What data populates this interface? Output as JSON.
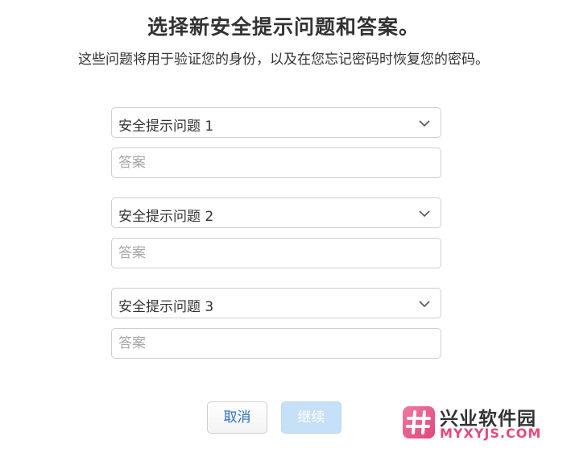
{
  "header": {
    "title": "选择新安全提示问题和答案。",
    "subtitle": "这些问题将用于验证您的身份，以及在您忘记密码时恢复您的密码。"
  },
  "questions": [
    {
      "select_label": "安全提示问题 1",
      "answer_placeholder": "答案",
      "answer_value": ""
    },
    {
      "select_label": "安全提示问题 2",
      "answer_placeholder": "答案",
      "answer_value": ""
    },
    {
      "select_label": "安全提示问题 3",
      "answer_placeholder": "答案",
      "answer_value": ""
    }
  ],
  "actions": {
    "cancel_label": "取消",
    "continue_label": "继续",
    "continue_enabled": false
  },
  "watermark": {
    "name": "兴业软件园",
    "url": "MYXYJS.COM"
  },
  "colors": {
    "link_blue": "#2a6fc4",
    "disabled_blue": "#c6e0f7",
    "watermark_pink": "#e24a7a"
  },
  "icons": {
    "dropdown": "chevron-down-icon",
    "watermark_logo": "hash-logo-icon"
  }
}
